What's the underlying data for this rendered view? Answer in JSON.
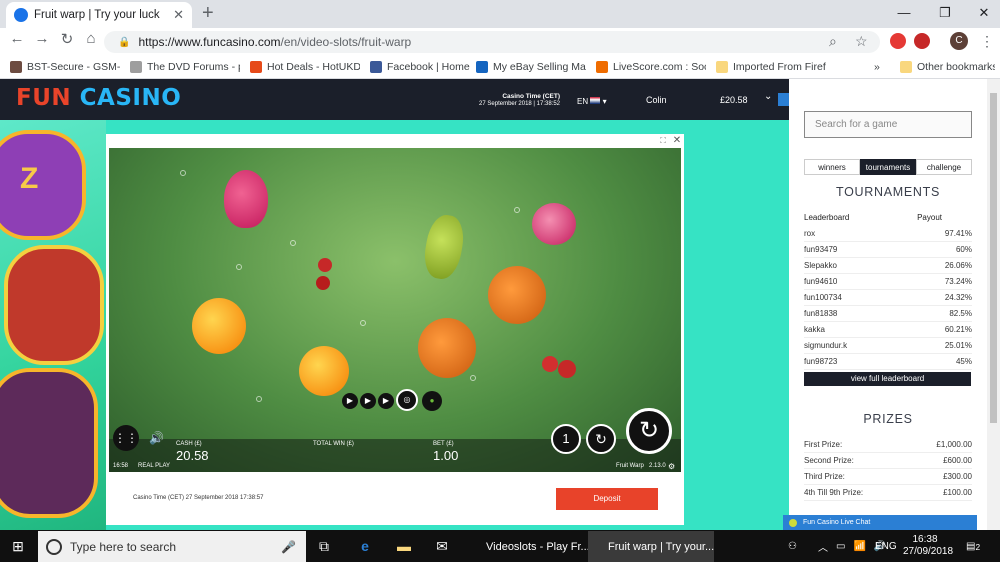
{
  "browser": {
    "tab_title": "Fruit warp | Try your luck",
    "url_host": "https://www.funcasino.com",
    "url_path": "/en/video-slots/fruit-warp",
    "bookmarks": [
      "BST-Secure - GSM-C...",
      "The DVD Forums - pe...",
      "Hot Deals - HotUKDe...",
      "Facebook | Home",
      "My eBay Selling Man...",
      "LiveScore.com : Socc...",
      "Imported From Firefo..."
    ],
    "other_bookmarks": "Other bookmarks",
    "overflow": "»",
    "profile_initial": "C"
  },
  "site": {
    "logo_part1": "FUN ",
    "logo_part2": "CASINO",
    "time_label": "Casino Time (CET)",
    "time_value": "27 September 2018 | 17:38:52",
    "lang": "EN",
    "user": "Colin",
    "balance": "£20.58",
    "chevron": "⌄"
  },
  "sidebar": {
    "search_placeholder": "Search for a game",
    "tabs": [
      "winners",
      "tournaments",
      "challenge"
    ],
    "tournaments_title": "TOURNAMENTS",
    "lb_header": {
      "left": "Leaderboard",
      "right": "Payout"
    },
    "leaderboard": [
      {
        "name": "rox",
        "payout": "97.41%"
      },
      {
        "name": "fun93479",
        "payout": "60%"
      },
      {
        "name": "Slepakko",
        "payout": "26.06%"
      },
      {
        "name": "fun94610",
        "payout": "73.24%"
      },
      {
        "name": "fun100734",
        "payout": "24.32%"
      },
      {
        "name": "fun81838",
        "payout": "82.5%"
      },
      {
        "name": "kakka",
        "payout": "60.21%"
      },
      {
        "name": "sigmundur.k",
        "payout": "25.01%"
      },
      {
        "name": "fun98723",
        "payout": "45%"
      }
    ],
    "leaderboard_btn": "view full leaderboard",
    "prizes_title": "PRIZES",
    "prizes": [
      {
        "label": "First Prize:",
        "value": "£1,000.00"
      },
      {
        "label": "Second Prize:",
        "value": "£600.00"
      },
      {
        "label": "Third Prize:",
        "value": "£300.00"
      },
      {
        "label": "4th Till 9th Prize:",
        "value": "£100.00"
      }
    ]
  },
  "game": {
    "cash_label": "CASH (£)",
    "cash_value": "20.58",
    "total_win_label": "TOTAL WIN (£)",
    "bet_label": "BET (£)",
    "bet_value": "1.00",
    "clock": "16:58",
    "mode": "REAL PLAY",
    "name": "Fruit Warp",
    "version": "2.13.0"
  },
  "modal": {
    "footer_time": "Casino Time (CET) 27 September 2018 17:38:57",
    "deposit_label": "Deposit"
  },
  "chat": {
    "label": "Fun Casino Live Chat"
  },
  "taskbar": {
    "search_placeholder": "Type here to search",
    "app1": "Videoslots - Play Fr...",
    "app2": "Fruit warp | Try your...",
    "lang": "ENG",
    "time": "16:38",
    "date": "27/09/2018",
    "notif": "2"
  },
  "colors": {
    "accent": "#e8432a",
    "brand_blue": "#29b6f6",
    "bg_teal": "#36e3c4",
    "dark": "#1b1f2a"
  }
}
